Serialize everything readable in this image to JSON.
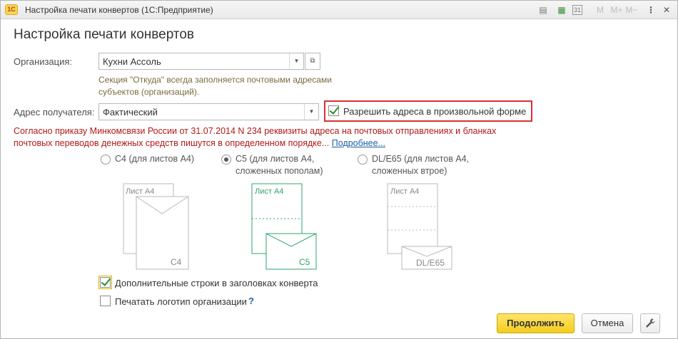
{
  "window": {
    "title": "Настройка печати конвертов  (1С:Предприятие)",
    "logo": "1С",
    "toolbar_icons": [
      "print-icon",
      "table-icon",
      "calendar-icon",
      "m-icon",
      "m-plus-icon",
      "m-minus-icon",
      "more-icon",
      "close-icon"
    ],
    "toolbar_glyphs": {
      "m": "M",
      "mplus": "M+",
      "mminus": "M−",
      "more": "⋮",
      "close": "✕",
      "print": "▤",
      "table": "▦",
      "calendar": "31"
    }
  },
  "form": {
    "heading": "Настройка печати конвертов",
    "organization": {
      "label": "Организация:",
      "value": "Кухни Ассоль"
    },
    "hint_line1": "Секция \"Откуда\" всегда заполняется почтовыми адресами",
    "hint_line2": "субъектов (организаций).",
    "recipient_address": {
      "label": "Адрес получателя:",
      "value": "Фактический"
    },
    "allow_free_form": {
      "label": "Разрешить адреса в произвольной форме",
      "checked": true
    },
    "warning_line1": "Согласно приказу Минкомсвязи России от 31.07.2014 N 234 реквизиты адреса на почтовых отправлениях и бланках",
    "warning_line2": "почтовых переводов денежных средств пишутся в определенном порядке...",
    "warning_link": "Подробнее..."
  },
  "formats": [
    {
      "line1": "C4 (для листов А4)",
      "line2": "",
      "selected": false,
      "sheet": "Лист А4",
      "env": "C4"
    },
    {
      "line1": "C5 (для листов А4,",
      "line2": "сложенных пополам)",
      "selected": true,
      "sheet": "Лист А4",
      "env": "C5"
    },
    {
      "line1": "DL/E65 (для листов А4,",
      "line2": "сложенных втрое)",
      "selected": false,
      "sheet": "Лист А4",
      "env": "DL/E65"
    }
  ],
  "options": {
    "extra_lines": {
      "label": "Дополнительные строки в заголовках конверта",
      "checked": true
    },
    "print_logo": {
      "label": "Печатать логотип организации",
      "checked": false,
      "help": "?"
    }
  },
  "buttons": {
    "continue": "Продолжить",
    "cancel": "Отмена",
    "settings_icon": "wrench-icon"
  },
  "colors": {
    "accent_green": "#2ea36b",
    "warning_red": "#b01916",
    "highlight_red": "#d93131",
    "primary_yellow": "#f4cd1c"
  }
}
